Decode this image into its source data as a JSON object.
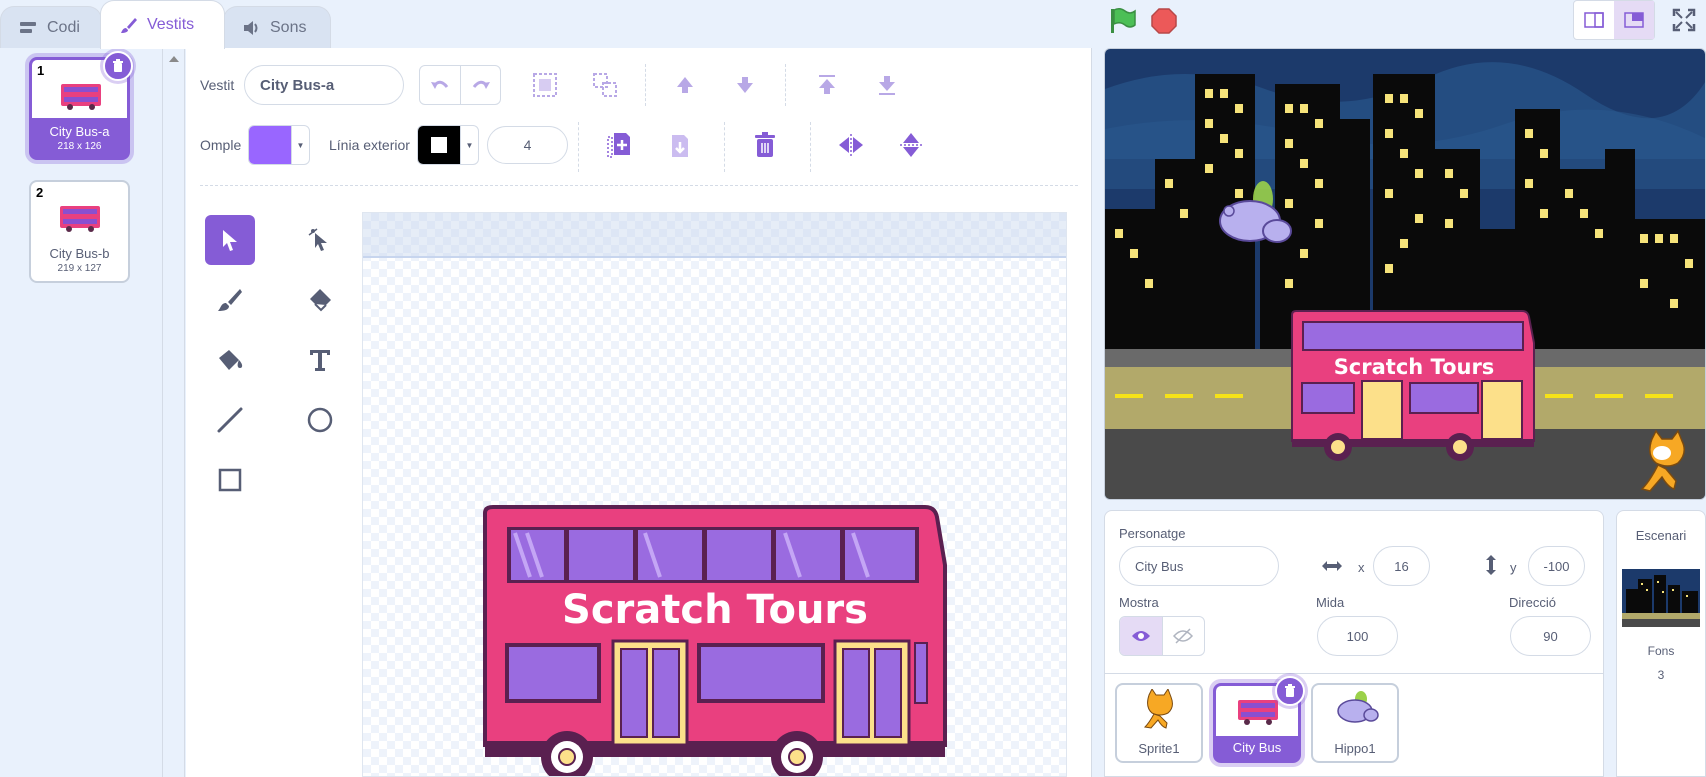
{
  "tabs": [
    {
      "label": "Codi",
      "icon": "code-icon"
    },
    {
      "label": "Vestits",
      "icon": "brush-icon"
    },
    {
      "label": "Sons",
      "icon": "speaker-icon"
    }
  ],
  "costumes": [
    {
      "number": "1",
      "name": "City Bus-a",
      "size": "218 x 126",
      "selected": true
    },
    {
      "number": "2",
      "name": "City Bus-b",
      "size": "219 x 127",
      "selected": false
    }
  ],
  "editor": {
    "costume_label": "Vestit",
    "costume_name": "City Bus-a",
    "fill_label": "Ompl​e",
    "fill_color": "#9966ff",
    "outline_label": "Línia exterior",
    "outline_color": "#000000",
    "outline_width": "4"
  },
  "canvas": {
    "bus_text": "Scratch Tours"
  },
  "stage": {
    "bus_text": "Scratch Tours"
  },
  "sprite_info": {
    "sprite_label": "Personatge",
    "sprite_name": "City Bus",
    "x_label": "x",
    "x_value": "16",
    "y_label": "y",
    "y_value": "-100",
    "show_label": "Mostra",
    "size_label": "Mida",
    "size_value": "100",
    "direction_label": "Direcció",
    "direction_value": "90"
  },
  "sprites": [
    {
      "name": "Sprite1",
      "selected": false
    },
    {
      "name": "City Bus",
      "selected": true
    },
    {
      "name": "Hippo1",
      "selected": false
    }
  ],
  "backdrop": {
    "title": "Escenari",
    "label": "Fons",
    "count": "3"
  },
  "colors": {
    "accent": "#855cd6",
    "bus_pink": "#e9407f",
    "green_flag": "#4cbf56",
    "stop": "#ec5959"
  }
}
